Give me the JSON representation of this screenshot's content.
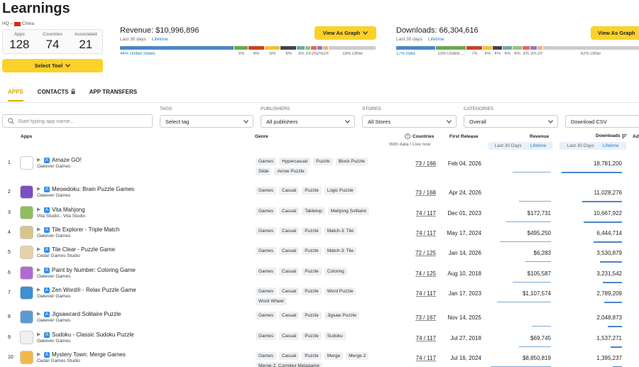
{
  "page": {
    "title": "Learnings"
  },
  "hq": {
    "label": "HQ –",
    "country": "China"
  },
  "stats": [
    {
      "label": "Apps",
      "value": "128"
    },
    {
      "label": "Countries",
      "value": "74"
    },
    {
      "label": "Associated",
      "value": "21"
    }
  ],
  "select_tool": {
    "label": "Select Tool"
  },
  "revenue_panel": {
    "title": "Revenue: $10,996,896",
    "period_active": "Last 30 days",
    "period_link": "Lifetime",
    "button": "View As Graph",
    "bars": [
      {
        "share": 44,
        "color": "#4a86c8",
        "label": "44% United States"
      },
      {
        "share": 5,
        "color": "#6aa84f",
        "label": "5%"
      },
      {
        "share": 6,
        "color": "#cc4125",
        "label": "6%"
      },
      {
        "share": 6,
        "color": "#f1c232",
        "label": "6%"
      },
      {
        "share": 6,
        "color": "#444444",
        "label": "6%"
      },
      {
        "share": 3,
        "color": "#76a5af",
        "label": "3%"
      },
      {
        "share": 2,
        "color": "#93c47d",
        "label": "2%"
      },
      {
        "share": 2,
        "color": "#e06666",
        "label": "2%"
      },
      {
        "share": 2,
        "color": "#8e7cc3",
        "label": "2%"
      },
      {
        "share": 2,
        "color": "#f6b26b",
        "label": "2%"
      },
      {
        "share": 18,
        "color": "#cccccc",
        "label": "18% Other"
      }
    ]
  },
  "downloads_panel": {
    "title": "Downloads: 66,304,616",
    "period_active": "Last 30 days",
    "period_link": "Lifetime",
    "button": "View As Graph",
    "bars": [
      {
        "share": 17,
        "color": "#4a86c8",
        "label": "17% India"
      },
      {
        "share": 13,
        "color": "#6aa84f",
        "label": "13% United ..."
      },
      {
        "share": 7,
        "color": "#cc4125",
        "label": "7%"
      },
      {
        "share": 4,
        "color": "#f1c232",
        "label": "4%"
      },
      {
        "share": 4,
        "color": "#444444",
        "label": "4%"
      },
      {
        "share": 4,
        "color": "#76a5af",
        "label": "4%"
      },
      {
        "share": 4,
        "color": "#93c47d",
        "label": "4%"
      },
      {
        "share": 3,
        "color": "#e06666",
        "label": "3%"
      },
      {
        "share": 3,
        "color": "#8e7cc3",
        "label": "3%"
      },
      {
        "share": 2,
        "color": "#f6b26b",
        "label": "2%"
      },
      {
        "share": 42,
        "color": "#cccccc",
        "label": "42% Other"
      }
    ]
  },
  "tabs": [
    {
      "label": "APPS",
      "active": true
    },
    {
      "label": "CONTACTS",
      "active": false
    },
    {
      "label": "APP TRANSFERS",
      "active": false
    }
  ],
  "filters": {
    "search_placeholder": "Start typing app name...",
    "tags": {
      "label": "TAGS",
      "value": "Select tag"
    },
    "publishers": {
      "label": "PUBLISHERS",
      "value": "All publishers"
    },
    "stores": {
      "label": "STORES",
      "value": "All Stores"
    },
    "categories": {
      "label": "CATEGORIES",
      "value": "Overall"
    },
    "download_csv": "Download CSV"
  },
  "table": {
    "headers": {
      "apps": "Apps",
      "genre": "Genre",
      "countries": "Countries",
      "countries_sub": "With data / Live now",
      "first_release": "First Release",
      "revenue": "Revenue",
      "downloads": "Downloads",
      "extra": "Ad"
    },
    "revenue_sub": {
      "active": "Last 30 Days",
      "link": "Lifetime"
    },
    "downloads_sub": {
      "active": "Last 30 Days",
      "link": "Lifetime"
    },
    "rows": [
      {
        "num": "1",
        "name": "Amaze GO!",
        "publisher": "Oakever Games",
        "icon_color": "#ffffff",
        "tags": [
          "Games",
          "Hypercasual",
          "Puzzle",
          "Block Puzzle",
          "Slide",
          "Arrow Puzzle"
        ],
        "countries": "73 / 166",
        "release": "Feb 04, 2026",
        "revenue": "",
        "revenue_trend": 0.6,
        "downloads": "18,781,200",
        "downloads_trend": 0.95
      },
      {
        "num": "2",
        "name": "Meowdoku: Brain Puzzle Games",
        "publisher": "Oakever Games",
        "icon_color": "#7b4fc4",
        "tags": [
          "Games",
          "Casual",
          "Puzzle",
          "Logic Puzzle"
        ],
        "countries": "73 / 168",
        "release": "Apr 24, 2026",
        "revenue": "",
        "revenue_trend": 0.5,
        "downloads": "11,028,276",
        "downloads_trend": 0.62
      },
      {
        "num": "3",
        "name": "Vita Mahjong",
        "publisher": "Vita Studio., Vita Studio",
        "icon_color": "#8fbf5a",
        "tags": [
          "Games",
          "Casual",
          "Tabletop",
          "Mahjong Solitaire"
        ],
        "countries": "74 / 117",
        "release": "Dec 01, 2023",
        "revenue": "$172,731",
        "revenue_trend": 0.7,
        "downloads": "10,667,922",
        "downloads_trend": 0.6
      },
      {
        "num": "4",
        "name": "Tile Explorer - Triple Match",
        "publisher": "Oakever Games",
        "icon_color": "#d9c48a",
        "tags": [
          "Games",
          "Casual",
          "Puzzle",
          "Match-3: Tile"
        ],
        "countries": "74 / 117",
        "release": "May 17, 2024",
        "revenue": "$495,250",
        "revenue_trend": 0.8,
        "downloads": "6,444,714",
        "downloads_trend": 0.45
      },
      {
        "num": "5",
        "name": "Tile Clear - Puzzle Game",
        "publisher": "Cedar Games Studio",
        "icon_color": "#e6d2a8",
        "tags": [
          "Games",
          "Casual",
          "Puzzle",
          "Match-3: Tile"
        ],
        "countries": "72 / 125",
        "release": "Jan 14, 2026",
        "revenue": "$6,283",
        "revenue_trend": 0.4,
        "downloads": "3,530,879",
        "downloads_trend": 0.35
      },
      {
        "num": "6",
        "name": "Paint by Number: Coloring Game",
        "publisher": "Oakever Games",
        "icon_color": "#b06ad1",
        "tags": [
          "Games",
          "Casual",
          "Puzzle",
          "Coloring"
        ],
        "countries": "74 / 125",
        "release": "Aug 10, 2018",
        "revenue": "$105,587",
        "revenue_trend": 0.6,
        "downloads": "3,231,542",
        "downloads_trend": 0.3
      },
      {
        "num": "7",
        "name": "Zen Word® - Relax Puzzle Game",
        "publisher": "Oakever Games",
        "icon_color": "#3e8ed0",
        "tags": [
          "Games",
          "Casual",
          "Puzzle",
          "Word Puzzle",
          "Word Wheel"
        ],
        "countries": "74 / 117",
        "release": "Jan 17, 2023",
        "revenue": "$1,107,574",
        "revenue_trend": 0.85,
        "downloads": "2,789,209",
        "downloads_trend": 0.28
      },
      {
        "num": "8",
        "name": "Jigsawcard Solitaire Puzzle",
        "publisher": "Oakever Games",
        "icon_color": "#5a9bd5",
        "tags": [
          "Games",
          "Casual",
          "Puzzle",
          "Jigsaw Puzzle"
        ],
        "countries": "73 / 167",
        "release": "Nov 14, 2025",
        "revenue": "",
        "revenue_trend": 0.3,
        "downloads": "2,048,873",
        "downloads_trend": 0.22
      },
      {
        "num": "9",
        "name": "Sudoku - Classic Sudoku Puzzle",
        "publisher": "Oakever Games",
        "icon_color": "#f0f0f0",
        "tags": [
          "Games",
          "Casual",
          "Puzzle",
          "Sudoku"
        ],
        "countries": "74 / 117",
        "release": "Jul 27, 2018",
        "revenue": "$69,745",
        "revenue_trend": 0.5,
        "downloads": "1,537,271",
        "downloads_trend": 0.18
      },
      {
        "num": "10",
        "name": "Mystery Town: Merge Games",
        "publisher": "Cedar Games Studio",
        "icon_color": "#f2b84b",
        "tags": [
          "Games",
          "Casual",
          "Puzzle",
          "Merge",
          "Merge-2",
          "Merge-2: Complex Metagame"
        ],
        "countries": "74 / 117",
        "release": "Jul 16, 2024",
        "revenue": "$8,850,819",
        "revenue_trend": 0.95,
        "downloads": "1,395,237",
        "downloads_trend": 0.15
      }
    ]
  }
}
